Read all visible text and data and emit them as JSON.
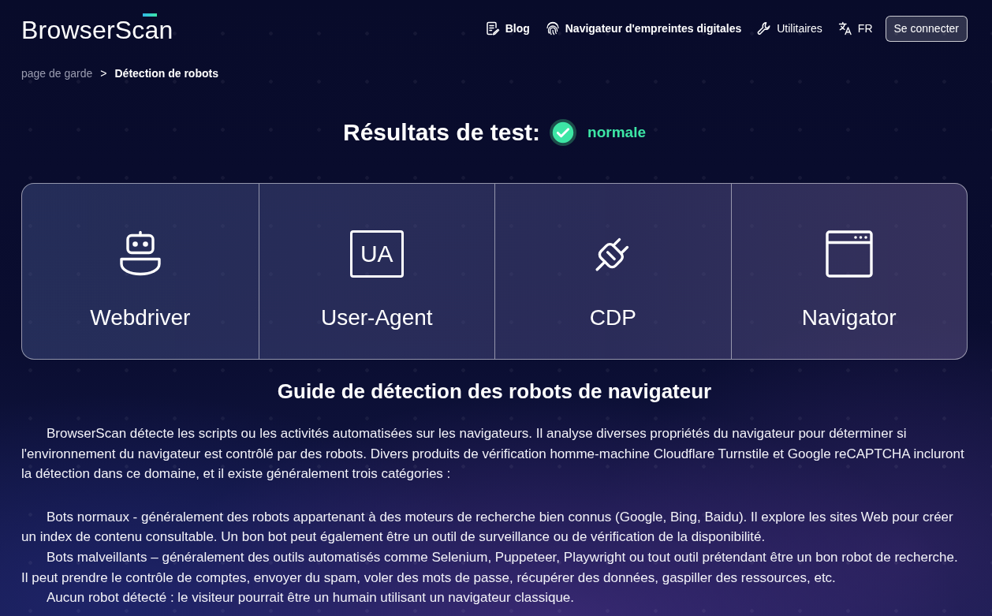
{
  "header": {
    "logo": "Browser**Scan**",
    "nav": [
      {
        "label": "Blog",
        "kind": "blog",
        "emphasized": true
      },
      {
        "label": "Navigateur d'empreintes digitales",
        "kind": "fingerprint",
        "emphasized": true
      },
      {
        "label": "Utilitaires",
        "kind": "tools",
        "emphasized": false
      }
    ],
    "language": "FR",
    "login_button": "Se connecter"
  },
  "breadcrumb": {
    "separator": ">",
    "items": [
      {
        "label": "page de garde",
        "current": false
      },
      {
        "label": "Détection de robots",
        "current": true
      }
    ]
  },
  "result": {
    "label": "Résultats de test:",
    "passed": true,
    "value": "normale"
  },
  "checks": [
    {
      "kind": "webdriver",
      "label": "Webdriver"
    },
    {
      "kind": "user_agent",
      "label": "User-Agent",
      "icon_text": "UA"
    },
    {
      "kind": "cdp",
      "label": "CDP"
    },
    {
      "kind": "navigator",
      "label": "Navigator"
    }
  ],
  "guide": {
    "title": "Guide de détection des robots de navigateur",
    "intro": "BrowserScan détecte les scripts ou les activités automatisées sur les navigateurs. Il analyse diverses propriétés du navigateur pour déterminer si l'environnement du navigateur est contrôlé par des robots. Divers produits de vérification homme-machine Cloudflare Turnstile et Google reCAPTCHA incluront la détection dans ce domaine, et il existe généralement trois catégories :",
    "categories": [
      "Bots normaux - généralement des robots appartenant à des moteurs de recherche bien connus (Google, Bing, Baidu). Il explore les sites Web pour créer un index de contenu consultable. Un bon bot peut également être un outil de surveillance ou de vérification de la disponibilité.",
      "Bots malveillants – généralement des outils automatisés comme Selenium, Puppeteer, Playwright ou tout outil prétendant être un bon robot de recherche. Il peut prendre le contrôle de comptes, envoyer du spam, voler des mots de passe, récupérer des données, gaspiller des ressources, etc.",
      "Aucun robot détecté : le visiteur pourrait être un humain utilisant un navigateur classique."
    ]
  }
}
